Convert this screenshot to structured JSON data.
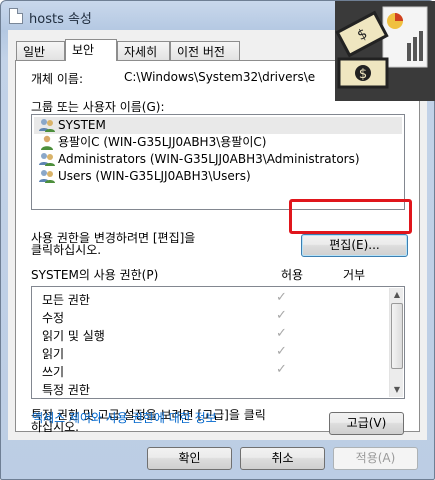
{
  "window": {
    "title": "hosts 속성"
  },
  "tabs": [
    "일반",
    "보안",
    "자세히",
    "이전 버전"
  ],
  "object_name_label": "개체 이름:",
  "object_name_value": "C:\\Windows\\System32\\drivers\\e",
  "group_label": "그룹 또는 사용자 이름(G):",
  "users": [
    "SYSTEM",
    "용팔이C (WIN-G35LJJ0ABH3\\용팔이C)",
    "Administrators (WIN-G35LJJ0ABH3\\Administrators)",
    "Users (WIN-G35LJJ0ABH3\\Users)"
  ],
  "edit_hint": "사용 권한을 변경하려면 [편집]을\n클릭하십시오.",
  "edit_button": "편집(E)...",
  "perm_header": {
    "title": "SYSTEM의 사용 권한(P)",
    "allow": "허용",
    "deny": "거부"
  },
  "permissions": [
    {
      "name": "모든 권한",
      "allow": "✓"
    },
    {
      "name": "수정",
      "allow": "✓"
    },
    {
      "name": "읽기 및 실행",
      "allow": "✓"
    },
    {
      "name": "읽기",
      "allow": "✓"
    },
    {
      "name": "쓰기",
      "allow": "✓"
    },
    {
      "name": "특정 권한",
      "allow": ""
    }
  ],
  "advanced_hint": "특정 권한 및 고급 설정을 보려면 [고급]을 클릭\n하십시오.",
  "advanced_button": "고급(V)",
  "help_link": "액세스 제어와 사용 권한에 대한 정보",
  "footer": {
    "ok": "확인",
    "cancel": "취소",
    "apply": "적용(A)"
  },
  "colors": {
    "highlight": "#e0161c",
    "link": "#0066cc"
  }
}
